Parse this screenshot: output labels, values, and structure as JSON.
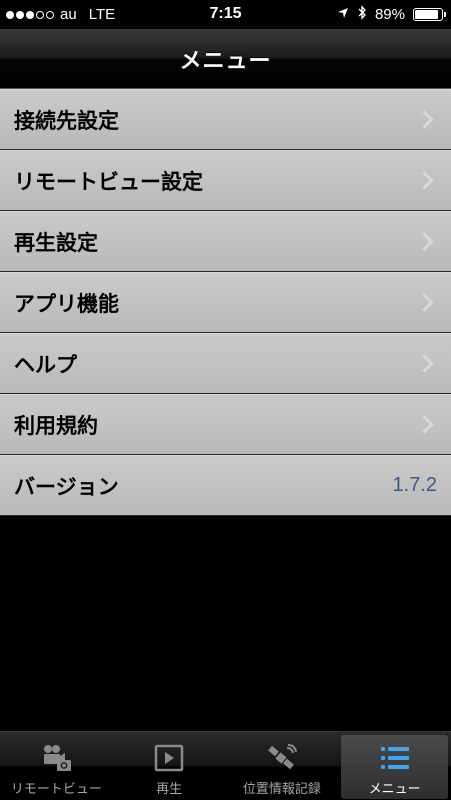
{
  "status_bar": {
    "carrier": "au",
    "network": "LTE",
    "time": "7:15",
    "battery": "89%",
    "battery_level": 0.89
  },
  "nav": {
    "title": "メニュー"
  },
  "menu": {
    "items": [
      {
        "label": "接続先設定"
      },
      {
        "label": "リモートビュー設定"
      },
      {
        "label": "再生設定"
      },
      {
        "label": "アプリ機能"
      },
      {
        "label": "ヘルプ"
      },
      {
        "label": "利用規約"
      }
    ],
    "version": {
      "label": "バージョン",
      "value": "1.7.2"
    }
  },
  "tabs": [
    {
      "label": "リモートビュー",
      "icon": "camera-icon"
    },
    {
      "label": "再生",
      "icon": "play-icon"
    },
    {
      "label": "位置情報記録",
      "icon": "satellite-icon"
    },
    {
      "label": "メニュー",
      "icon": "list-icon",
      "selected": true
    }
  ],
  "colors": {
    "accent": "#3b5a8c",
    "list_icon": "#3fa6f0"
  }
}
